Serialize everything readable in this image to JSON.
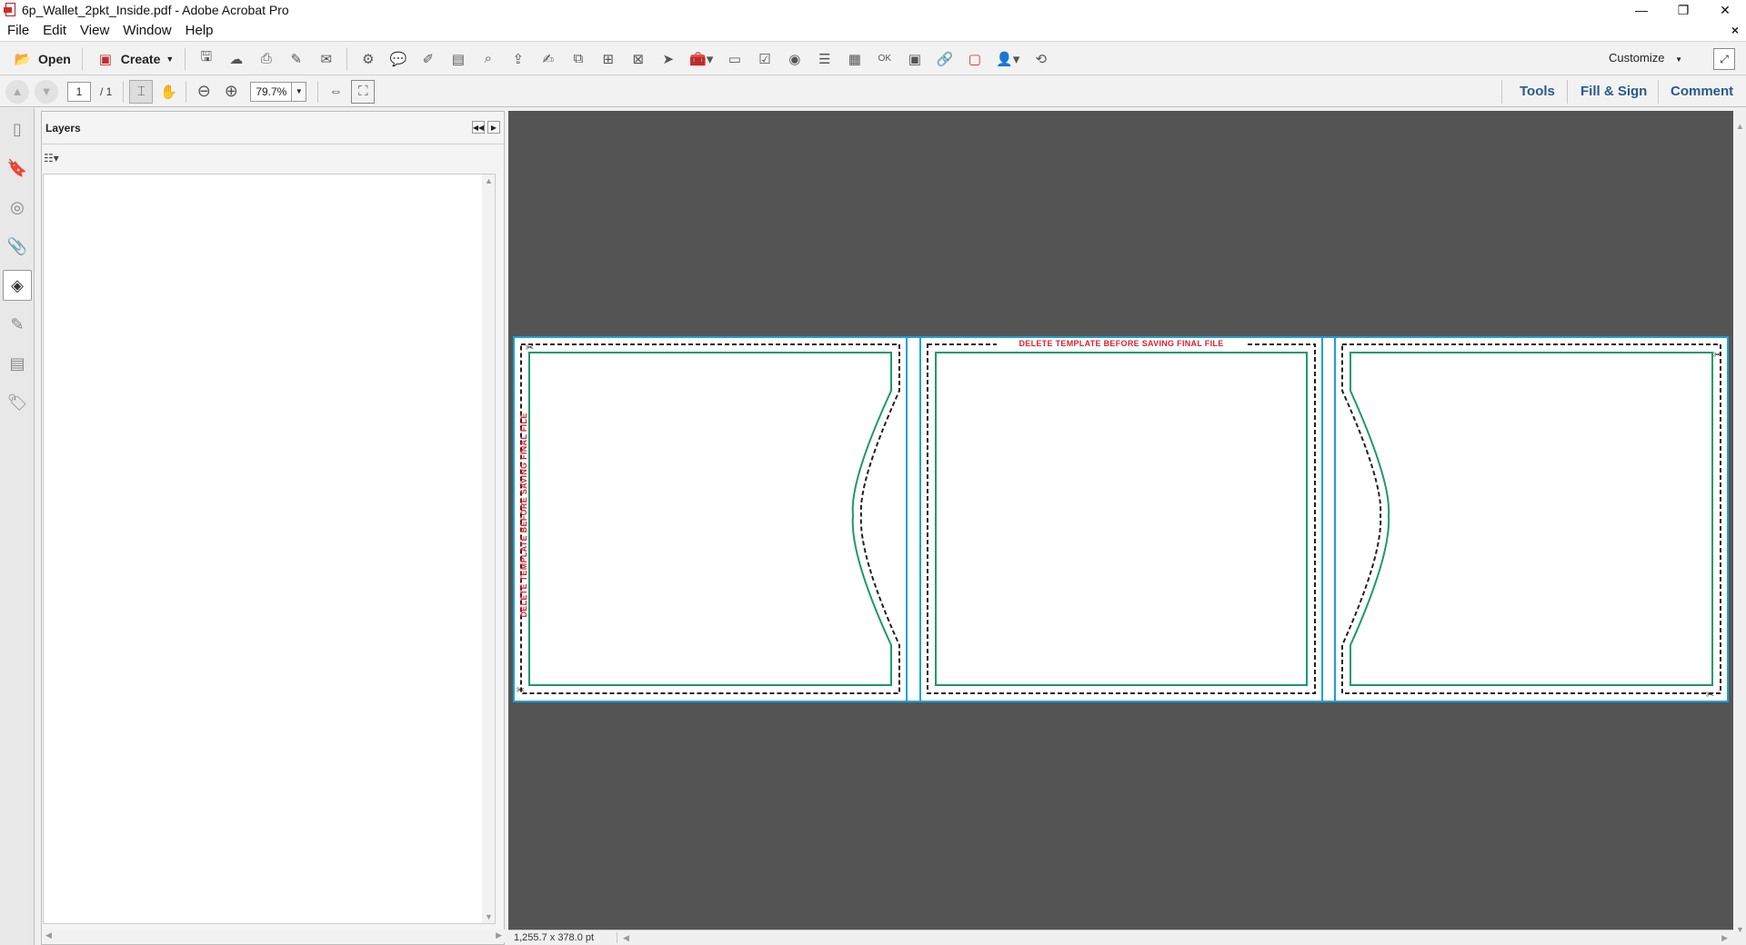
{
  "window": {
    "title": "6p_Wallet_2pkt_Inside.pdf - Adobe Acrobat Pro",
    "minimize": "—",
    "restore": "❐",
    "close": "✕",
    "doc_close": "×"
  },
  "menu": [
    "File",
    "Edit",
    "View",
    "Window",
    "Help"
  ],
  "toolbar": {
    "open_label": "Open",
    "create_label": "Create",
    "customize_label": "Customize"
  },
  "navigation": {
    "current_page": "1",
    "total_pages": "/ 1",
    "zoom": "79.7%"
  },
  "pane_links": {
    "tools": "Tools",
    "fill_sign": "Fill & Sign",
    "comment": "Comment"
  },
  "layers_panel": {
    "title": "Layers"
  },
  "document": {
    "template_warning_top": "DELETE TEMPLATE BEFORE SAVING FINAL FILE",
    "template_warning_side": "DELETE TEMPLATE BEFORE SAVING FINAL FILE",
    "colors": {
      "bleed_blue": "#1aa0d8",
      "trim_green": "#1a9a6a",
      "warning_red": "#e02030",
      "canvas": "#545454"
    }
  },
  "status": {
    "dimensions": "1,255.7 x 378.0 pt"
  }
}
